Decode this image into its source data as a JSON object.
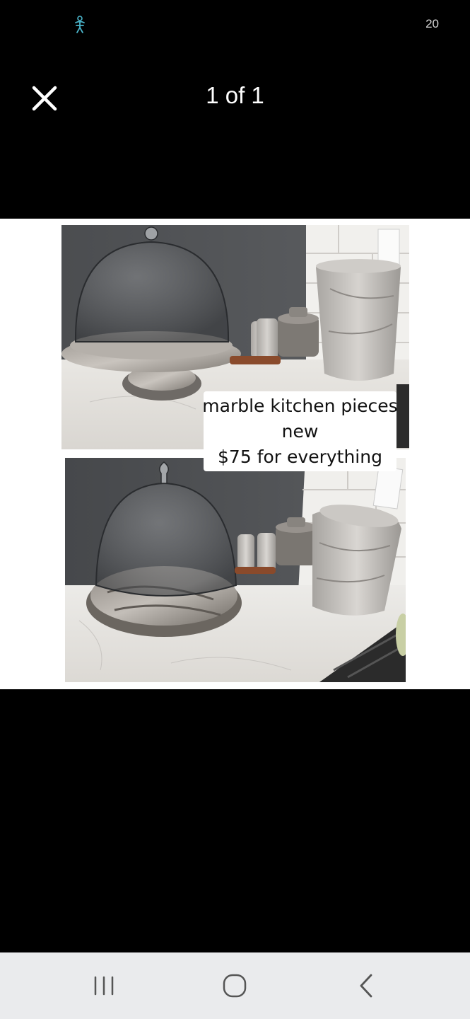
{
  "status_bar": {
    "notification_icon": "accessibility-figure-icon",
    "indicator_text": "20"
  },
  "viewer": {
    "close_icon": "close-icon",
    "counter": "1 of 1"
  },
  "photo": {
    "caption_lines": [
      "marble kitchen pieces",
      "new",
      "$75 for everything"
    ]
  },
  "nav_bar": {
    "recents_icon": "recents-icon",
    "home_icon": "home-icon",
    "back_icon": "back-chevron-icon"
  },
  "colors": {
    "background": "#000000",
    "photo_background": "#ffffff",
    "nav_bar": "#eaebed",
    "status_icon": "#4ab3c9"
  }
}
